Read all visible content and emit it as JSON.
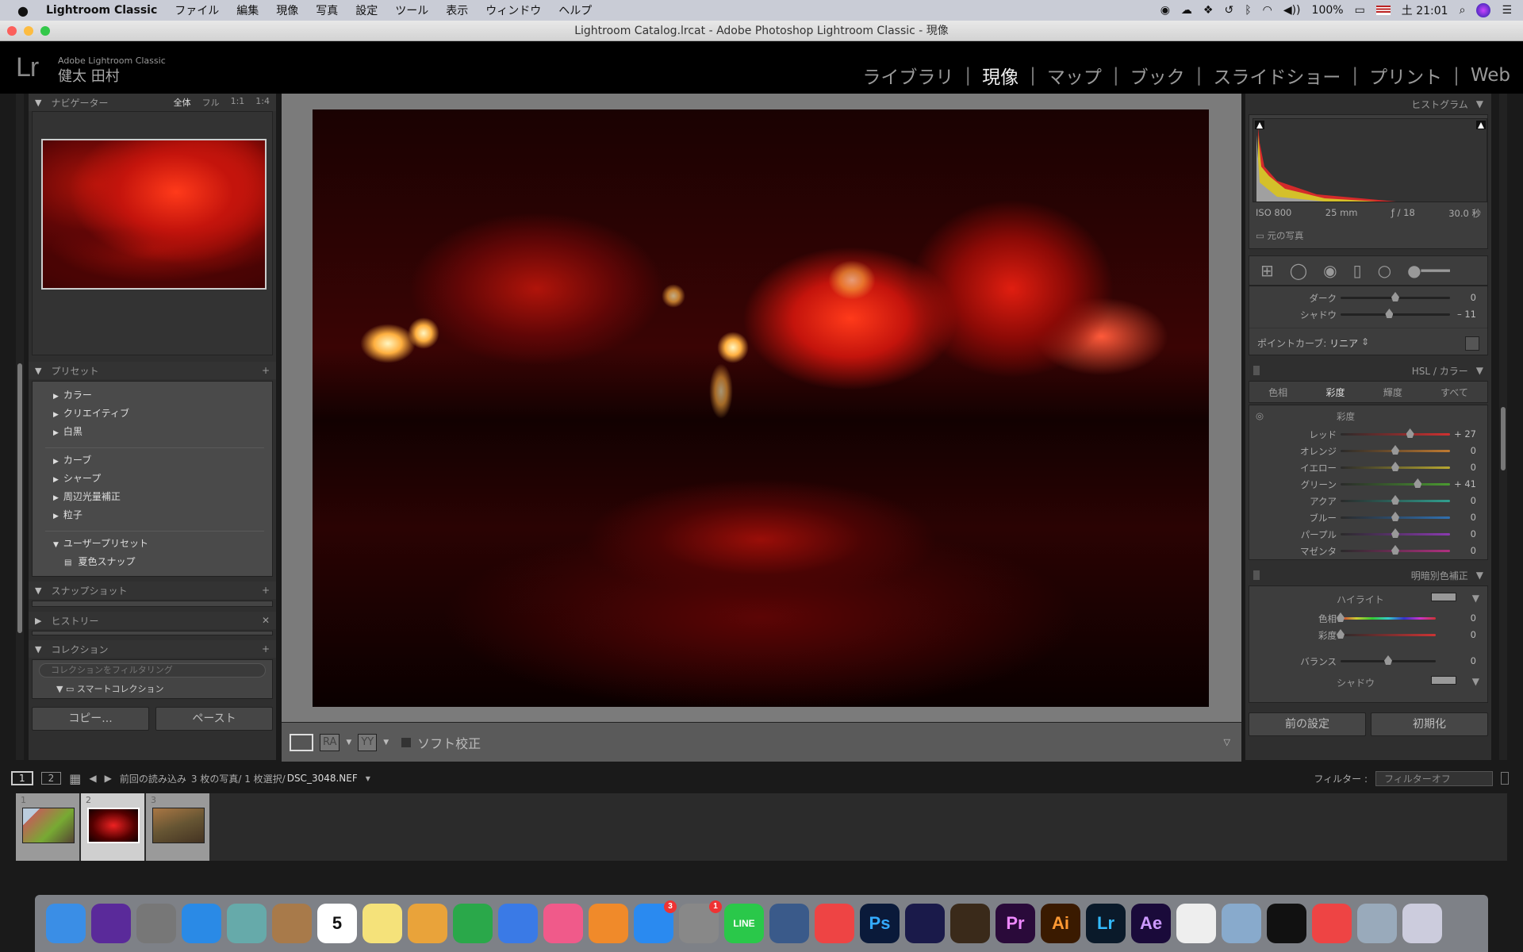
{
  "menubar": {
    "apple": "",
    "app": "Lightroom Classic",
    "items": [
      "ファイル",
      "編集",
      "現像",
      "写真",
      "設定",
      "ツール",
      "表示",
      "ウィンドウ",
      "ヘルプ"
    ],
    "battery": "100%",
    "clock": "土 21:01"
  },
  "window": {
    "title": "Lightroom Catalog.lrcat - Adobe Photoshop Lightroom Classic - 現像"
  },
  "identity": {
    "logo": "Lr",
    "product": "Adobe Lightroom Classic",
    "user": "健太 田村"
  },
  "modules": [
    {
      "label": "ライブラリ"
    },
    {
      "label": "現像",
      "active": true
    },
    {
      "label": "マップ"
    },
    {
      "label": "ブック"
    },
    {
      "label": "スライドショー"
    },
    {
      "label": "プリント"
    },
    {
      "label": "Web"
    }
  ],
  "left": {
    "navigator": {
      "title": "ナビゲーター",
      "zoom": [
        "全体",
        "フル",
        "1:1",
        "1:4"
      ]
    },
    "presets": {
      "title": "プリセット",
      "groups": [
        [
          "カラー",
          "クリエイティブ",
          "白黒"
        ],
        [
          "カーブ",
          "シャープ",
          "周辺光量補正",
          "粒子"
        ]
      ],
      "user_folder": "ユーザープリセット",
      "user_item": "夏色スナップ"
    },
    "snapshots": "スナップショット",
    "history": "ヒストリー",
    "collections": "コレクション",
    "collection_filter_placeholder": "コレクションをフィルタリング",
    "smart_collection": "スマートコレクション",
    "copy": "コピー...",
    "paste": "ペースト"
  },
  "toolbar": {
    "soft_proof": "ソフト校正",
    "ra": "RA",
    "yy": "YY"
  },
  "right": {
    "histogram": {
      "title": "ヒストグラム",
      "iso": "ISO 800",
      "focal": "25 mm",
      "aperture": "ƒ / 18",
      "shutter": "30.0 秒",
      "original": "元の写真"
    },
    "tone_curve": {
      "sliders": [
        {
          "label": "ダーク",
          "value": 0
        },
        {
          "label": "シャドウ",
          "value": -11
        }
      ],
      "point_curve_label": "ポイントカーブ:",
      "point_curve_value": "リニア"
    },
    "hsl": {
      "title": "HSL / カラー",
      "tabs": [
        "色相",
        "彩度",
        "輝度",
        "すべて"
      ],
      "active_tab": "彩度",
      "section": "彩度",
      "sliders": [
        {
          "label": "レッド",
          "value": 27,
          "color": "#d03030"
        },
        {
          "label": "オレンジ",
          "value": 0,
          "color": "#c07a30"
        },
        {
          "label": "イエロー",
          "value": 0,
          "color": "#b8a830"
        },
        {
          "label": "グリーン",
          "value": 41,
          "color": "#4a9a30"
        },
        {
          "label": "アクア",
          "value": 0,
          "color": "#30a090"
        },
        {
          "label": "ブルー",
          "value": 0,
          "color": "#3070b0"
        },
        {
          "label": "パープル",
          "value": 0,
          "color": "#8a3ab0"
        },
        {
          "label": "マゼンタ",
          "value": 0,
          "color": "#b03080"
        }
      ]
    },
    "split_toning": {
      "title": "明暗別色補正",
      "highlight": "ハイライト",
      "shadow": "シャドウ",
      "hue": "色相",
      "saturation": "彩度",
      "hue_value": 0,
      "sat_value": 0,
      "balance": "バランス",
      "balance_value": 0
    },
    "previous": "前の設定",
    "reset": "初期化"
  },
  "filmstrip": {
    "source": "前回の読み込み",
    "info": "3 枚の写真/ 1 枚選択/",
    "file": "DSC_3048.NEF",
    "filter_label": "フィルター :",
    "filter_value": "フィルターオフ",
    "cells": [
      "1",
      "2",
      "3"
    ],
    "selected": 2
  },
  "dock": [
    "finder",
    "siri",
    "launchpad",
    "safari",
    "preview",
    "contacts",
    "calendar",
    "notes",
    "keynote",
    "numbers",
    "keynote-stand",
    "itunes",
    "ibooks",
    "app-store",
    "system-preferences",
    "line",
    "quicktime",
    "chrome",
    "photoshop",
    "media-encoder",
    "bridge",
    "premiere",
    "illustrator",
    "lightroom",
    "after-effects",
    "textedit",
    "photos",
    "nikon",
    "pinwheel",
    "image-capture",
    "trash"
  ],
  "dock_badges": {
    "app-store": "3",
    "system-preferences": "1"
  },
  "dock_labels": {
    "calendar": "5",
    "photoshop": "Ps",
    "premiere": "Pr",
    "illustrator": "Ai",
    "lightroom": "Lr",
    "after-effects": "Ae",
    "line": "LINE"
  }
}
